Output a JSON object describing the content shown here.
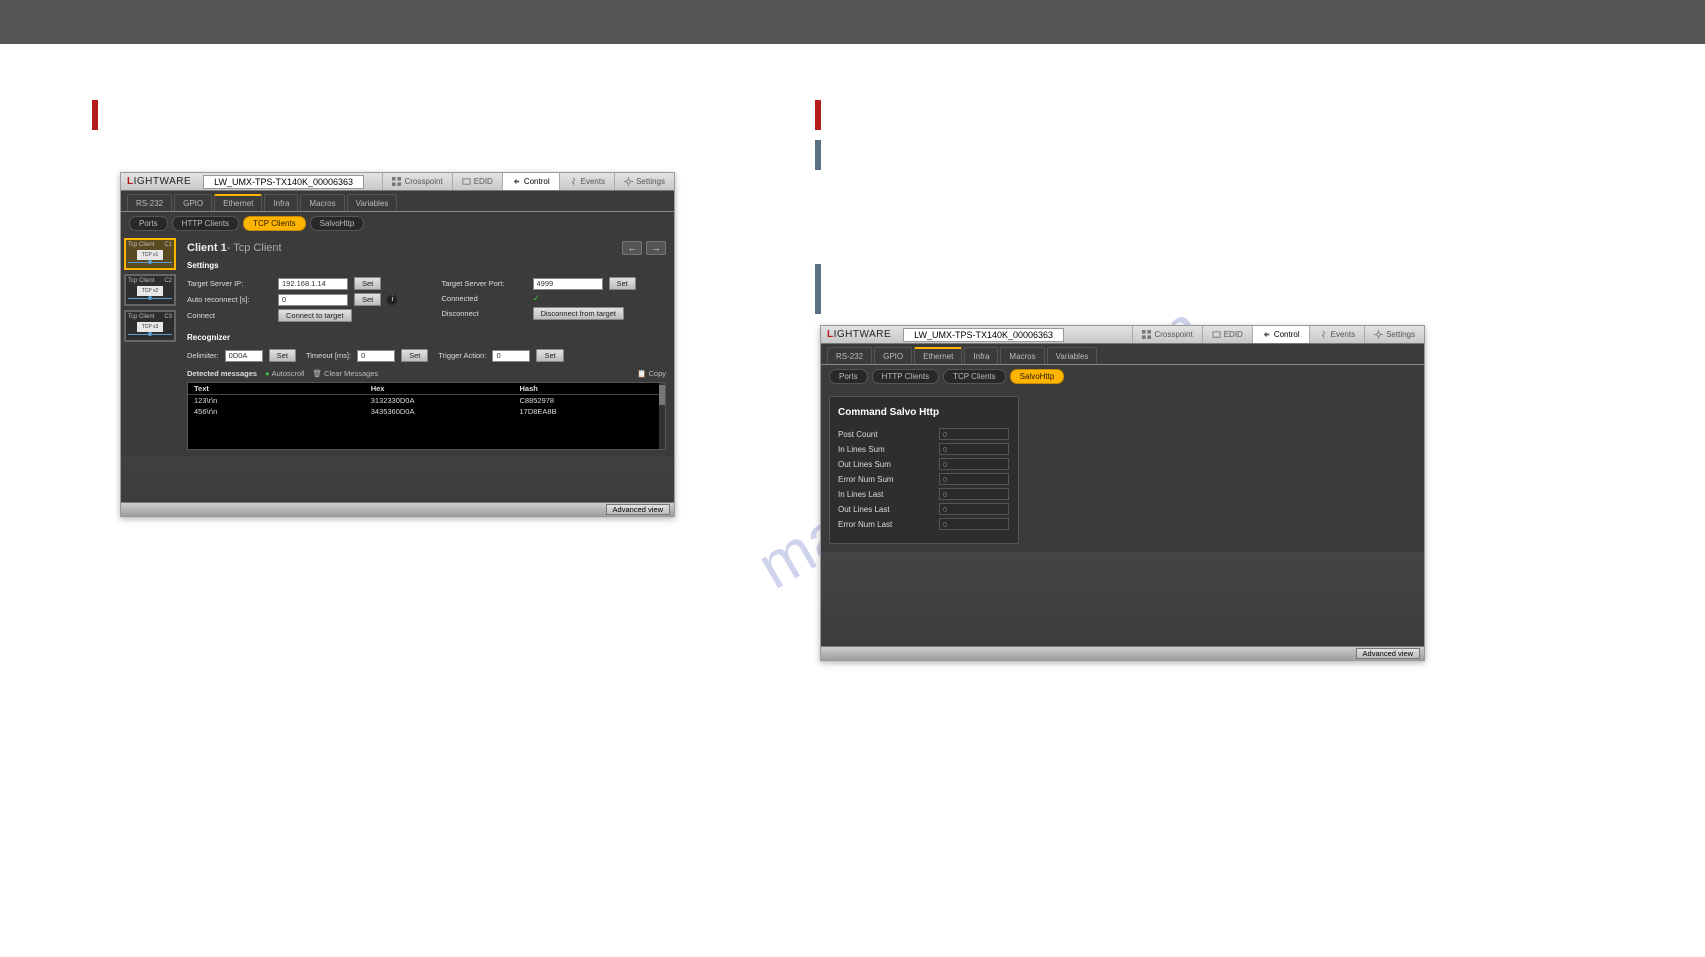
{
  "watermark": "manualshive.com",
  "window1": {
    "device": "LW_UMX-TPS-TX140K_00006363",
    "logo_l": "L",
    "logo_rest": "IGHTWARE",
    "hdr_tabs": [
      "Crosspoint",
      "EDID",
      "Control",
      "Events",
      "Settings"
    ],
    "subtabs": [
      "RS-232",
      "GPIO",
      "Ethernet",
      "Infra",
      "Macros",
      "Variables"
    ],
    "subsubtabs": [
      "Ports",
      "HTTP Clients",
      "TCP Clients",
      "SalvoHttp"
    ],
    "sidebar": [
      {
        "name": "Tcp Client",
        "badge": "C1",
        "box": "TCP x1"
      },
      {
        "name": "Tcp Client",
        "badge": "C2",
        "box": "TCP x2"
      },
      {
        "name": "Tcp Client",
        "badge": "C3",
        "box": "TCP x3"
      }
    ],
    "title_client": "Client 1",
    "title_sub": " - Tcp Client",
    "sect_settings": "Settings",
    "labels": {
      "ip": "Target Server IP:",
      "port": "Target Server Port:",
      "auto": "Auto reconnect [s]:",
      "connected": "Connected",
      "connect": "Connect",
      "disconnect": "Disconnect"
    },
    "vals": {
      "ip": "192.168.1.14",
      "port": "4999",
      "auto": "0"
    },
    "btns": {
      "set": "Set",
      "connectTarget": "Connect to target",
      "disconnectTarget": "Disconnect from target"
    },
    "sect_recognizer": "Recognizer",
    "rec": {
      "delimiter_lbl": "Delimiter:",
      "delimiter_val": "0D0A",
      "timeout_lbl": "Timeout [ms]:",
      "timeout_val": "0",
      "trigger_lbl": "Trigger Action:",
      "trigger_val": "0"
    },
    "detected": "Detected messages",
    "autoscroll": "Autoscroll",
    "clear": "Clear Messages",
    "copy": "Copy",
    "cols": [
      "Text",
      "Hex",
      "Hash"
    ],
    "rows": [
      {
        "text": "123\\r\\n",
        "hex": "3132330D0A",
        "hash": "C8852978"
      },
      {
        "text": "456\\r\\n",
        "hex": "3435360D0A",
        "hash": "17D8EA8B"
      }
    ],
    "advanced": "Advanced view"
  },
  "window2": {
    "device": "LW_UMX-TPS-TX140K_00006363",
    "hdr_tabs": [
      "Crosspoint",
      "EDID",
      "Control",
      "Events",
      "Settings"
    ],
    "subtabs": [
      "RS-232",
      "GPIO",
      "Ethernet",
      "Infra",
      "Macros",
      "Variables"
    ],
    "subsubtabs": [
      "Ports",
      "HTTP Clients",
      "TCP Clients",
      "SalvoHttp"
    ],
    "title": "Command Salvo Http",
    "fields": [
      {
        "lbl": "Post Count",
        "val": "0"
      },
      {
        "lbl": "In Lines Sum",
        "val": "0"
      },
      {
        "lbl": "Out Lines Sum",
        "val": "0"
      },
      {
        "lbl": "Error Num Sum",
        "val": "0"
      },
      {
        "lbl": "In Lines Last",
        "val": "0"
      },
      {
        "lbl": "Out Lines Last",
        "val": "0"
      },
      {
        "lbl": "Error Num Last",
        "val": "0"
      }
    ],
    "advanced": "Advanced view"
  }
}
